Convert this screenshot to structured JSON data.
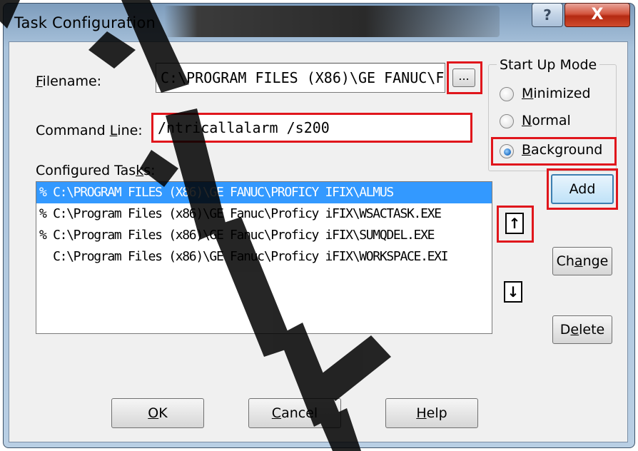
{
  "window": {
    "title": "Task Configuration",
    "caption_help": "?",
    "caption_close": "X"
  },
  "filename": {
    "label": "Filename:",
    "value": "C:\\PROGRAM FILES (X86)\\GE FANUC\\F",
    "browse_label": "..."
  },
  "command_line": {
    "label": "Command Line:",
    "value": "/ntricallalarm /s200"
  },
  "startup_mode": {
    "title": "Start Up Mode",
    "options": [
      {
        "label": "Minimized",
        "checked": false
      },
      {
        "label": "Normal",
        "checked": false
      },
      {
        "label": "Background",
        "checked": true
      }
    ]
  },
  "configured_tasks": {
    "label": "Configured Tasks:",
    "items": [
      "% C:\\PROGRAM FILES (X86)\\GE FANUC\\PROFICY IFIX\\ALMUS",
      "% C:\\Program Files (x86)\\GE Fanuc\\Proficy iFIX\\WSACTASK.EXE",
      "% C:\\Program Files (x86)\\GE Fanuc\\Proficy iFIX\\SUMQDEL.EXE",
      "  C:\\Program Files (x86)\\GE Fanuc\\Proficy iFIX\\WORKSPACE.EXI"
    ],
    "selected_index": 0
  },
  "buttons": {
    "add": "Add",
    "move_up": "↑",
    "move_down": "↓",
    "change": "Change",
    "delete": "Delete",
    "ok": "OK",
    "cancel": "Cancel",
    "help": "Help"
  },
  "colors": {
    "highlight": "#e0161c",
    "selection": "#3399ff"
  }
}
